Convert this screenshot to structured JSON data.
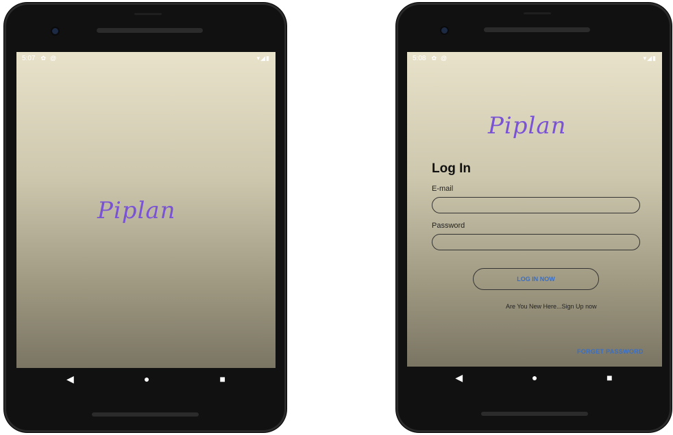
{
  "splash": {
    "status_time": "5:07",
    "logo": "Piplan"
  },
  "login": {
    "status_time": "5:08",
    "logo": "Piplan",
    "title": "Log In",
    "email_label": "E-mail",
    "email_value": "",
    "password_label": "Password",
    "password_value": "",
    "login_button": "LOG IN NOW",
    "signup_link": "Are You New Here...Sign Up now",
    "forgot_link": "FORGET PASSWORD"
  },
  "icons": {
    "status_left": [
      "settings-icon",
      "at-sign-icon"
    ],
    "status_right": [
      "wifi-icon",
      "signal-icon",
      "battery-icon"
    ],
    "nav": [
      "back-icon",
      "home-icon",
      "recents-icon"
    ]
  },
  "colors": {
    "logo": "#7a52d6",
    "link": "#3a6ec2",
    "screen_top": "#e9e2ca",
    "screen_bottom": "#7a7563",
    "phone_body": "#111111"
  }
}
